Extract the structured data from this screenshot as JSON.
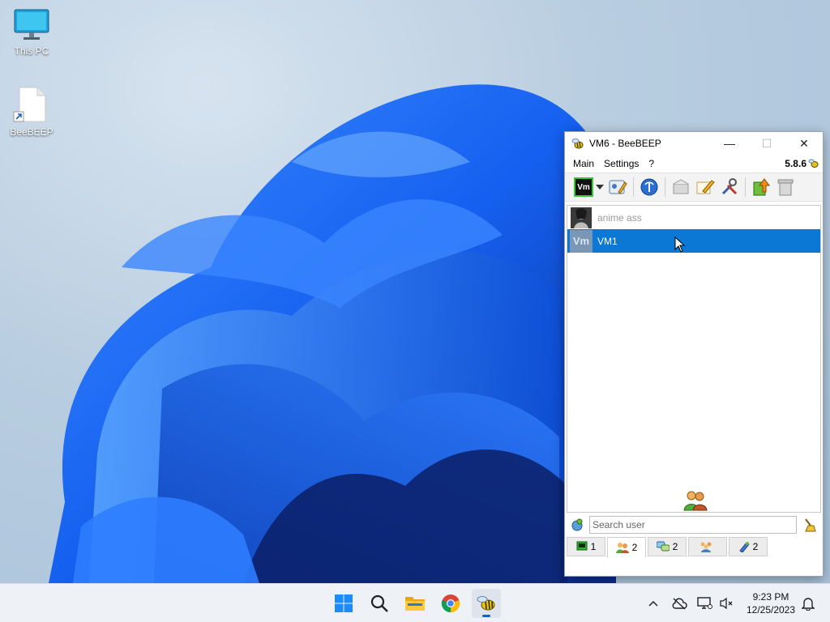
{
  "desktop": {
    "icons": [
      {
        "label": "This PC"
      },
      {
        "label": "BeeBEEP"
      }
    ]
  },
  "window": {
    "title": "VM6 - BeeBEEP",
    "menu": [
      "Main",
      "Settings",
      "?"
    ],
    "version": "5.8.6",
    "toolbar_profile": "Vm",
    "users": [
      {
        "name": "anime ass",
        "status": "offline"
      },
      {
        "name": "VM1",
        "avatar": "Vm",
        "status": "selected"
      }
    ],
    "search": {
      "placeholder": "Search user",
      "value": ""
    },
    "tabs": [
      {
        "icon": "chat-icon",
        "count": "1"
      },
      {
        "icon": "users-icon",
        "count": "2"
      },
      {
        "icon": "chats-icon",
        "count": "2"
      },
      {
        "icon": "groups-icon",
        "count": ""
      },
      {
        "icon": "plugin-icon",
        "count": "2"
      }
    ]
  },
  "taskbar": {
    "clock_time": "9:23 PM",
    "clock_date": "12/25/2023"
  },
  "colors": {
    "selection": "#0b78d6",
    "accent": "#0a67c9"
  }
}
